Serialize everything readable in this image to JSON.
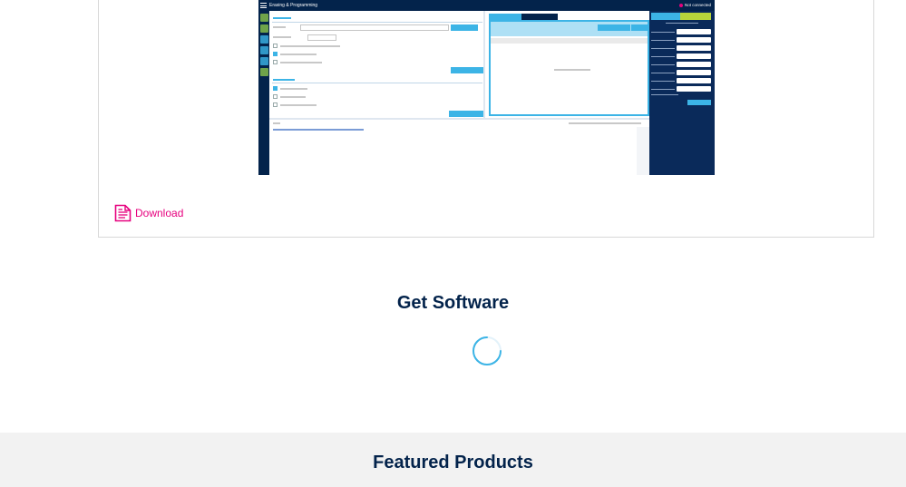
{
  "screenshot": {
    "title": "Erasing & Programming",
    "connection_status": "Not connected"
  },
  "download": {
    "label": "Download"
  },
  "get_software": {
    "title": "Get Software"
  },
  "featured_products": {
    "title": "Featured Products"
  },
  "colors": {
    "brand_dark": "#03234b",
    "accent_blue": "#3cb4e6",
    "link_pink": "#e6007e",
    "featured_bg": "#f2f2f2"
  },
  "icons": {
    "download": "document-icon",
    "loading": "spinner-icon"
  }
}
